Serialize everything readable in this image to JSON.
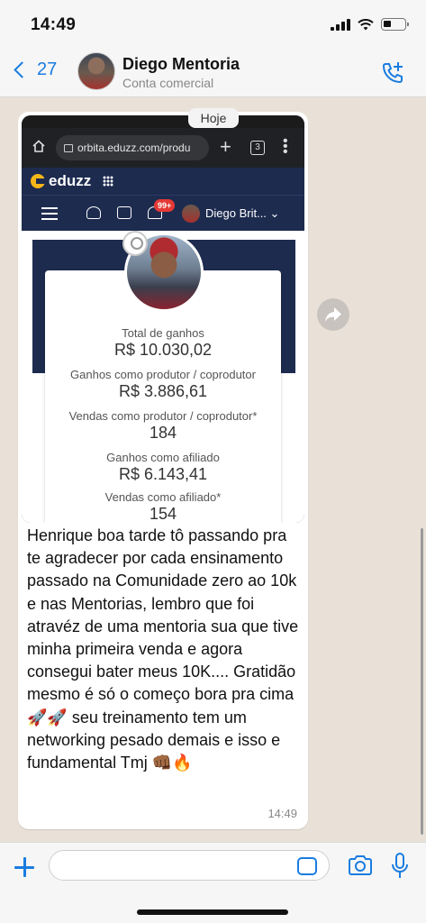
{
  "status_bar": {
    "time": "14:49"
  },
  "header": {
    "back_count": "27",
    "contact_name": "Diego Mentoria",
    "contact_subtitle": "Conta comercial"
  },
  "chat": {
    "date_pill": "Hoje",
    "message": {
      "text": "Henrique boa tarde tô passando pra te agradecer por cada ensinamento passado na Comunidade zero ao 10k e nas Mentorias, lembro que foi atravéz de uma mentoria sua que tive minha primeira venda e agora consegui bater meus 10K.... Gratidão mesmo é só o começo bora pra cima 🚀🚀 seu treinamento tem um networking pesado demais e isso e fundamental Tmj 👊🏾🔥",
      "time": "14:49"
    },
    "screenshot": {
      "url": "orbita.eduzz.com/produ",
      "tab_count": "3",
      "logo": "eduzz",
      "notification_badge": "99+",
      "user_name": "Diego Brit...",
      "stats": [
        {
          "label": "Total de ganhos",
          "value": "R$ 10.030,02"
        },
        {
          "label": "Ganhos como produtor / coprodutor",
          "value": "R$ 3.886,61"
        },
        {
          "label": "Vendas como produtor / coprodutor*",
          "value": "184"
        },
        {
          "label": "Ganhos como afiliado",
          "value": "R$ 6.143,41"
        },
        {
          "label": "Vendas como afiliado*",
          "value": "154"
        }
      ]
    }
  },
  "input_bar": {
    "placeholder": ""
  },
  "colors": {
    "accent": "#1a7ce0",
    "chat_bg": "#e9e1d7",
    "bubble": "#ffffff",
    "eduzz_navy": "#1d2b4f",
    "eduzz_yellow": "#f5b618"
  },
  "icons": [
    "back-chevron-icon",
    "add-call-icon",
    "forward-icon",
    "plus-icon",
    "sticker-icon",
    "camera-icon",
    "microphone-icon"
  ]
}
